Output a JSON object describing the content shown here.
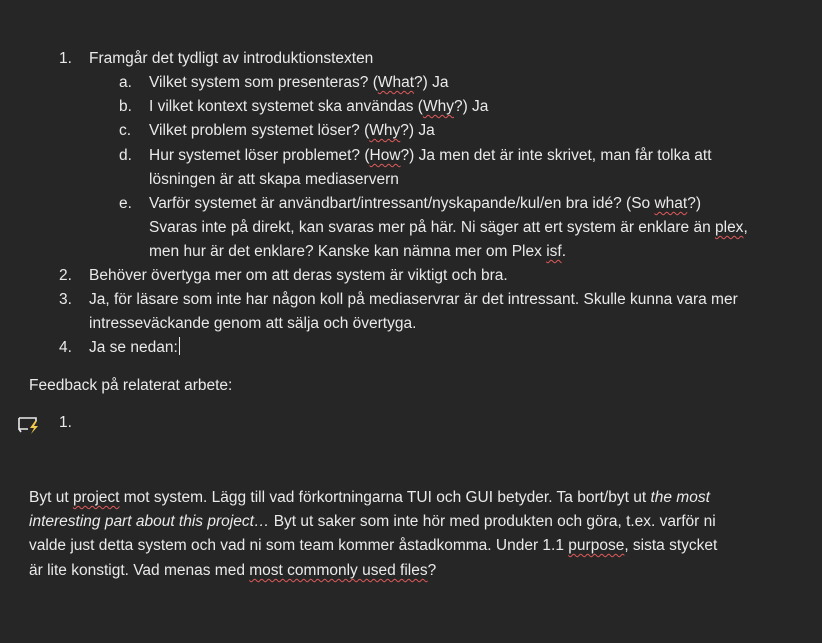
{
  "list1": {
    "item1": {
      "num": "1.",
      "text": "Framgår det tydligt av introduktionstexten"
    },
    "subs": [
      {
        "letter": "a.",
        "pre": "Vilket system som presenteras? (",
        "sq": "What",
        "post": "?) Ja"
      },
      {
        "letter": "b.",
        "pre": "I vilket kontext systemet ska användas (",
        "sq": "Why",
        "post": "?) Ja"
      },
      {
        "letter": "c.",
        "pre": "Vilket problem systemet löser? (",
        "sq": "Why",
        "post": "?) Ja"
      },
      {
        "letter": "d.",
        "pre": "Hur systemet löser problemet? (",
        "sq": "How",
        "post": "?) Ja men det är inte skrivet, man får tolka att",
        "line2": "lösningen är att skapa mediaservern"
      },
      {
        "letter": "e.",
        "pre": "Varför systemet är användbart/intressant/nyskapande/kul/en bra idé? (So ",
        "sq": "what",
        "post": "?)",
        "line2_pre": "Svaras inte på direkt, kan svaras mer på här. Ni säger att ert system är enklare än ",
        "line2_sq": "plex",
        "line2_post": ",",
        "line3_pre": "men hur är det enklare? Kanske kan nämna mer om Plex ",
        "line3_sq": "isf",
        "line3_post": "."
      }
    ],
    "item2": {
      "num": "2.",
      "text": "Behöver övertyga mer om att deras system är viktigt och bra."
    },
    "item3": {
      "num": "3.",
      "text": "Ja, för läsare som inte har någon koll på mediaservrar är det intressant. Skulle kunna vara mer",
      "line2": "intresseväckande genom att sälja och övertyga."
    },
    "item4": {
      "num": "4.",
      "text": "Ja se nedan:"
    }
  },
  "heading": "Feedback på relaterat arbete:",
  "list2": {
    "num": "1."
  },
  "paragraph": {
    "l1_a": "Byt ut ",
    "l1_sq": "project",
    "l1_b": " mot system. Lägg till vad förkortningarna TUI och GUI betyder. Ta bort/byt ut ",
    "l1_em": "the most",
    "l2_em": "interesting part about this project…",
    "l2_b": " Byt ut saker som inte hör med produkten och göra, t.ex. varför ni",
    "l3": "valde just detta system och vad ni som team kommer åstadkomma. Under 1.1 ",
    "l3_sq": "purpose",
    "l3_b": ", sista stycket",
    "l4_a": "är lite konstigt. Vad menas med ",
    "l4_sq": "most commonly used files",
    "l4_b": "?"
  },
  "colors": {
    "background": "#262626",
    "text": "#eaeaea",
    "spellcheck": "#e05a5a",
    "icon_accent": "#f2c94c"
  },
  "icons": {
    "comment": "comment-lightning-icon"
  }
}
